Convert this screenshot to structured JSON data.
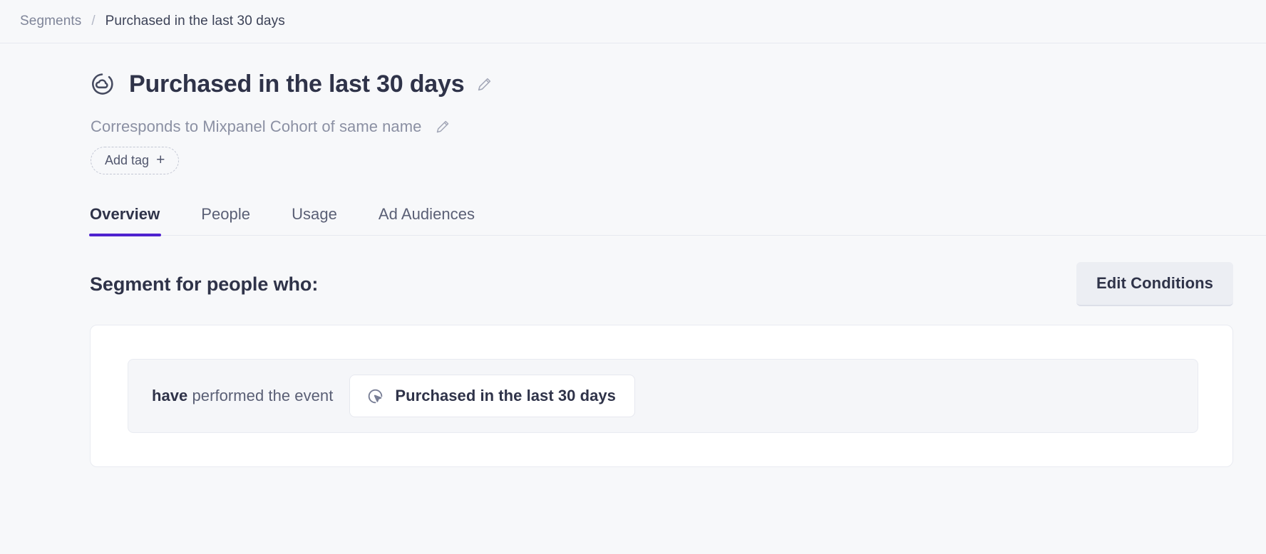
{
  "breadcrumb": {
    "parent": "Segments",
    "separator": "/",
    "current": "Purchased in the last 30 days"
  },
  "header": {
    "icon": "segment-cloud-icon",
    "title": "Purchased in the last 30 days",
    "title_edit_icon": "pencil-icon",
    "subtitle": "Corresponds to Mixpanel Cohort of same name",
    "subtitle_edit_icon": "pencil-icon",
    "add_tag_label": "Add tag",
    "add_tag_glyph": "+"
  },
  "tabs": [
    {
      "label": "Overview",
      "active": true
    },
    {
      "label": "People",
      "active": false
    },
    {
      "label": "Usage",
      "active": false
    },
    {
      "label": "Ad Audiences",
      "active": false
    }
  ],
  "section": {
    "title": "Segment for people who:",
    "edit_conditions_label": "Edit Conditions"
  },
  "condition": {
    "prefix_bold": "have",
    "prefix_rest": " performed the event",
    "event_icon": "cursor-click-icon",
    "event_name": "Purchased in the last 30 days"
  },
  "colors": {
    "accent": "#4f22cf",
    "page_background": "#f7f8fa",
    "card_background": "#ffffff",
    "text_primary": "#2f3349",
    "text_secondary": "#8b90a3",
    "button_background": "#eceef3"
  }
}
